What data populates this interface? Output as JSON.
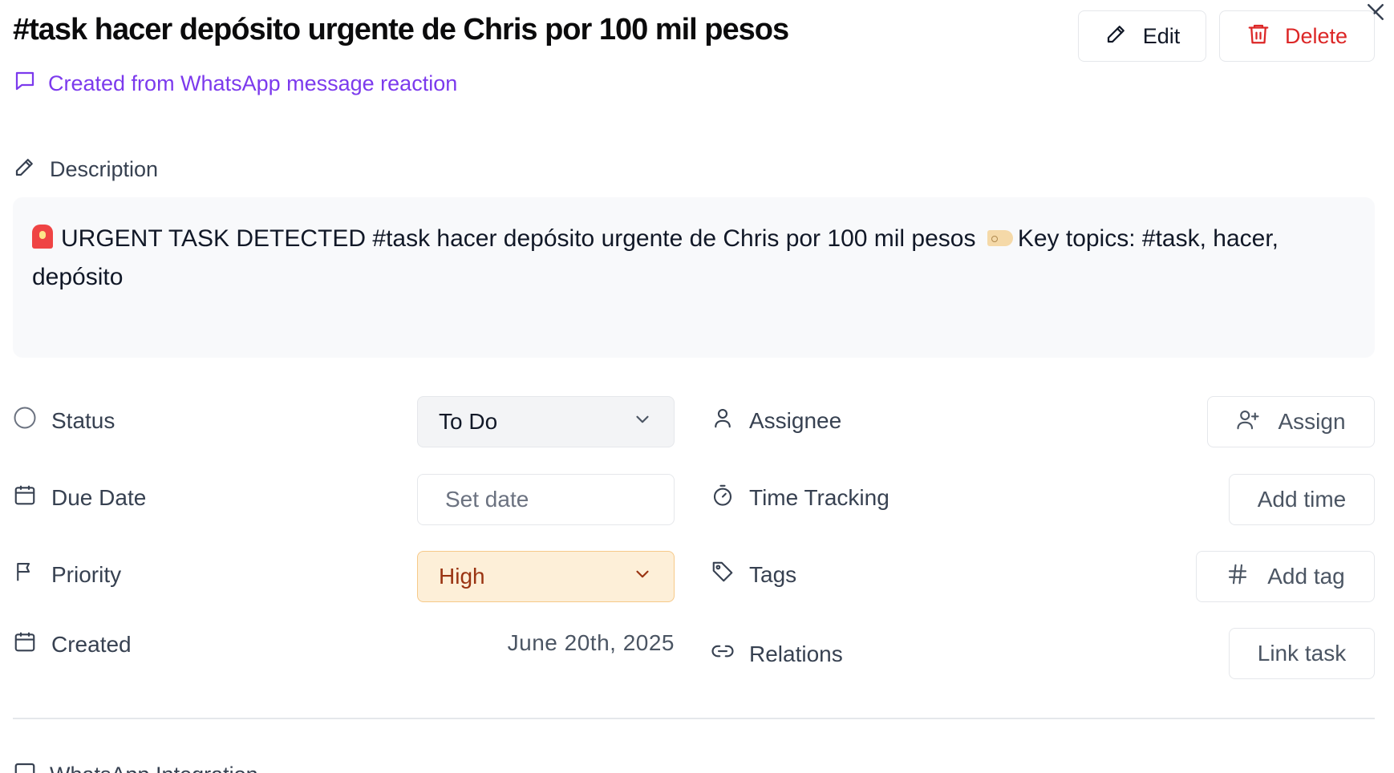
{
  "header": {
    "title": "#task hacer depósito urgente de Chris por 100 mil pesos",
    "edit_label": "Edit",
    "delete_label": "Delete",
    "source_text": "Created from WhatsApp message reaction"
  },
  "description": {
    "label": "Description",
    "text_part1": "URGENT TASK DETECTED #task hacer depósito urgente de Chris por 100 mil pesos",
    "text_part2": "Key topics: #task, hacer, depósito"
  },
  "properties": {
    "status": {
      "label": "Status",
      "value": "To Do"
    },
    "due_date": {
      "label": "Due Date",
      "placeholder": "Set date"
    },
    "priority": {
      "label": "Priority",
      "value": "High"
    },
    "created": {
      "label": "Created",
      "value": "June 20th, 2025"
    },
    "assignee": {
      "label": "Assignee",
      "button": "Assign"
    },
    "time_tracking": {
      "label": "Time Tracking",
      "button": "Add time"
    },
    "tags": {
      "label": "Tags",
      "button": "Add tag"
    },
    "relations": {
      "label": "Relations",
      "button": "Link task"
    }
  },
  "sections": {
    "whatsapp_label": "WhatsApp Integration"
  },
  "colors": {
    "accent": "#7c3aed",
    "danger": "#dc2626",
    "priority_bg": "#fdefd8",
    "priority_text": "#9a3412"
  }
}
